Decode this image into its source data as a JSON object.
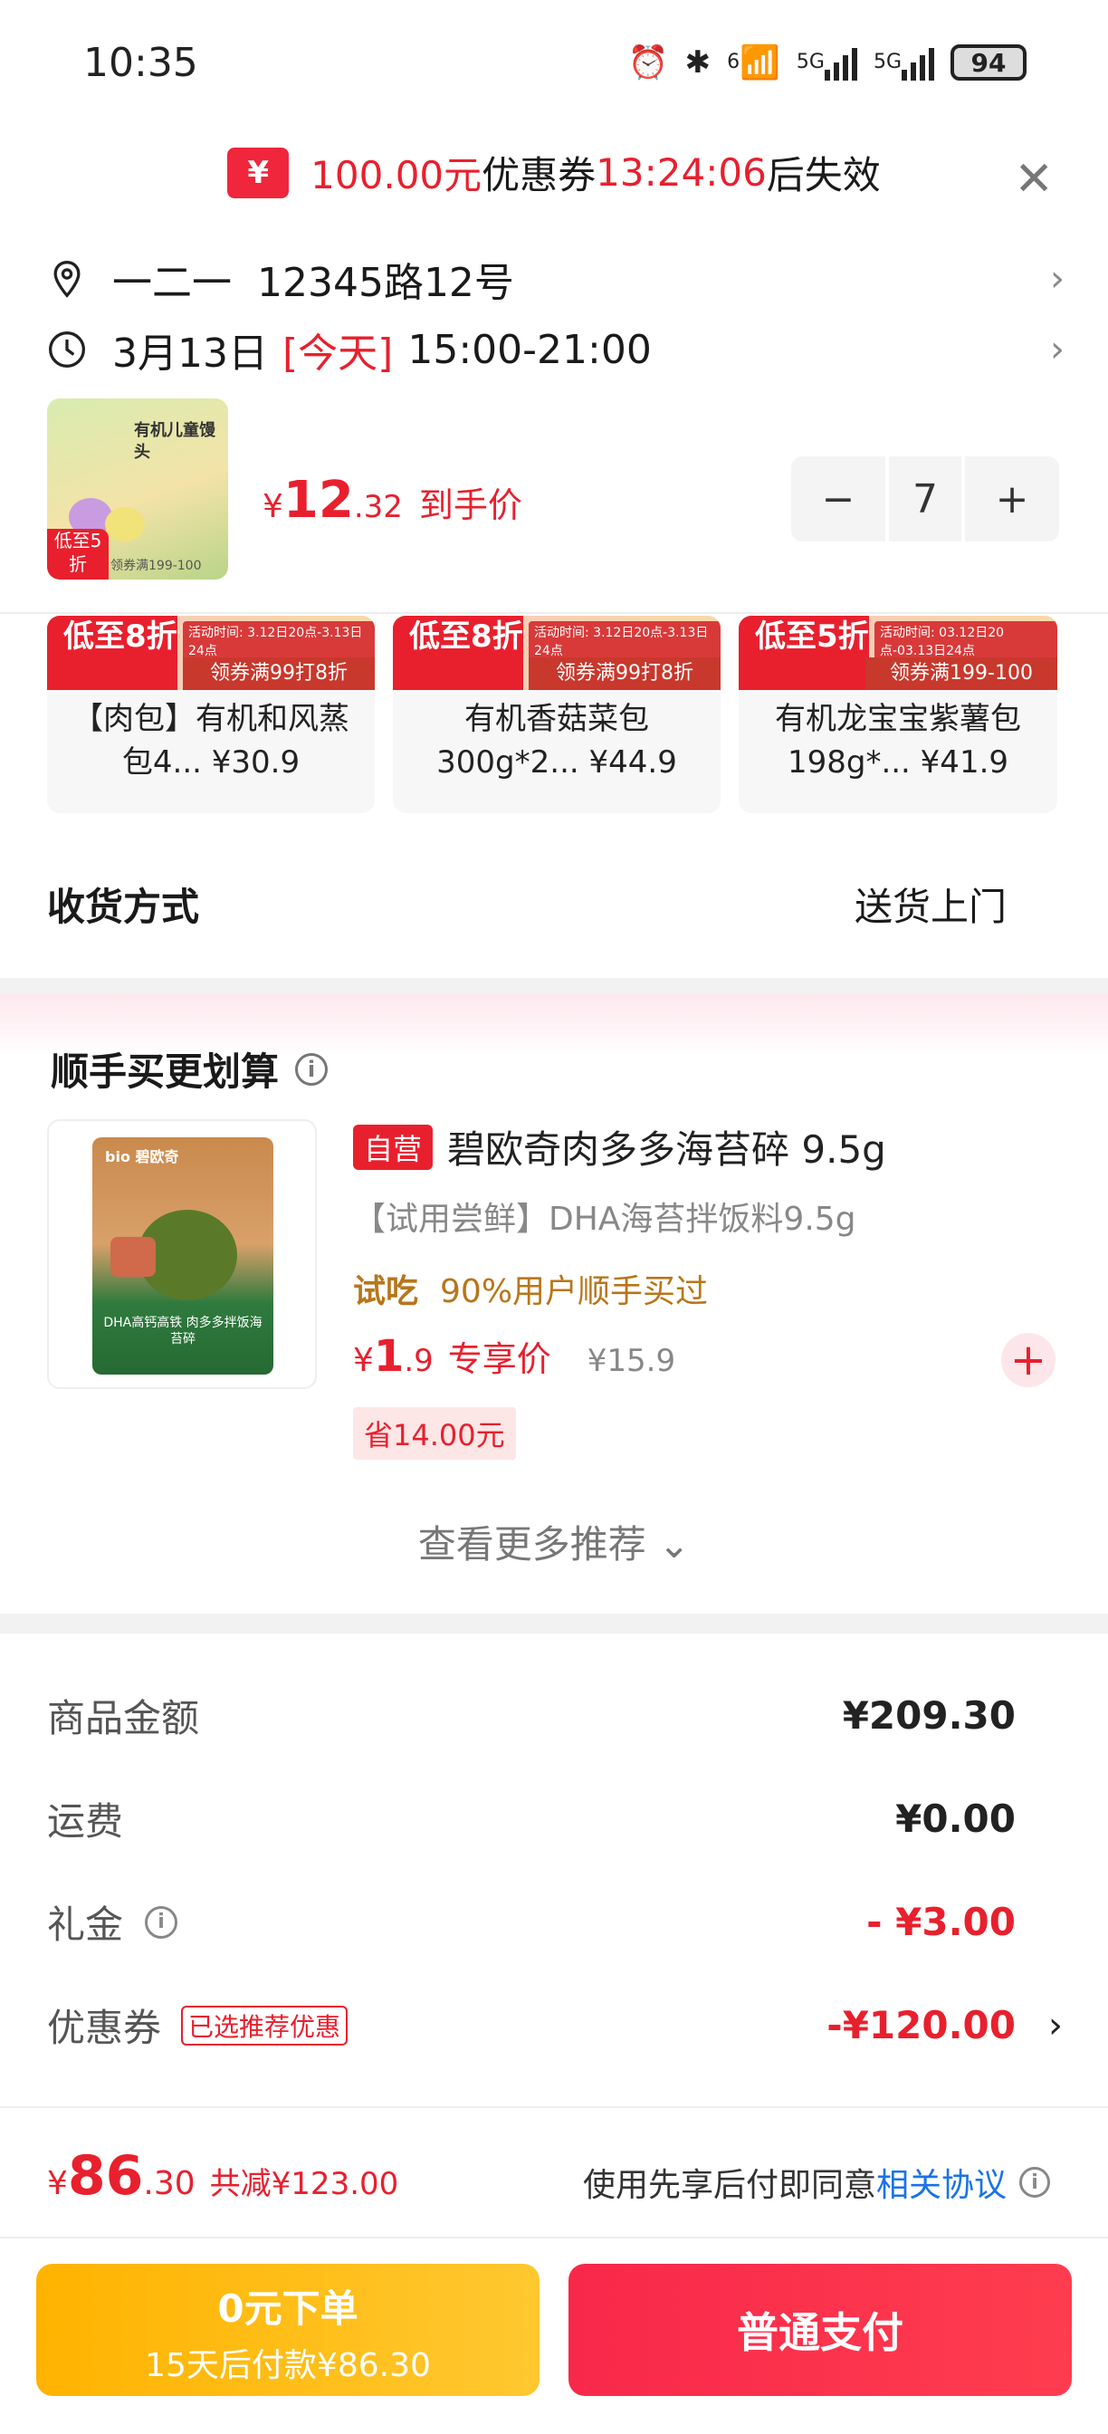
{
  "status_bar": {
    "time": "10:35",
    "signal_1": "5G",
    "signal_2": "5G",
    "wifi_label": "6",
    "battery": "94"
  },
  "coupon_banner": {
    "amount": "100.00元",
    "middle": "优惠券",
    "countdown": "13:24:06",
    "suffix": "后失效",
    "icon_char": "¥"
  },
  "address": {
    "text": "一二一  12345路12号"
  },
  "delivery_time": {
    "date": "3月13日",
    "today": "[今天]",
    "window": "15:00-21:00"
  },
  "product": {
    "thumb_name": "有机儿童馒头",
    "thumb_badge": "低至5折",
    "thumb_coupon": "领券满199-100",
    "price_currency": "¥",
    "price_int": "12",
    "price_dec": ".32",
    "price_label": "到手价",
    "quantity": "7",
    "minus": "−",
    "plus": "+"
  },
  "recommendations": [
    {
      "tag": "低至8折",
      "time": "活动时间: 3.12日20点-3.13日24点",
      "deal": "领券满99打8折",
      "title": "【肉包】有机和风蒸包4... ¥30.9"
    },
    {
      "tag": "低至8折",
      "time": "活动时间: 3.12日20点-3.13日24点",
      "deal": "领券满99打8折",
      "title": "有机香菇菜包300g*2... ¥44.9"
    },
    {
      "tag": "低至5折",
      "time": "活动时间: 03.12日20点-03.13日24点",
      "deal": "领券满199-100",
      "title": "有机龙宝宝紫薯包198g*... ¥41.9"
    }
  ],
  "shipping": {
    "label": "收货方式",
    "value": "送货上门"
  },
  "combo": {
    "title": "顺手买更划算",
    "info_icon": "i",
    "self_tag": "自营",
    "name": "碧欧奇肉多多海苔碎 9.5g",
    "sub": "【试用尝鲜】DHA海苔拌饭料9.5g",
    "trial_tag": "试吃",
    "trial_text": "90%用户顺手买过",
    "price_currency": "¥",
    "price_int": "1",
    "price_dec": ".9",
    "price_label": "专享价",
    "orig_price": "¥15.9",
    "save": "省14.00元",
    "bag_brand": "bio 碧欧奇",
    "bag_text": "DHA高钙高铁 肉多多拌饭海苔碎",
    "add": "+"
  },
  "more_rec": "查看更多推荐 ⌄",
  "summary": {
    "goods_label": "商品金额",
    "goods_value": "¥209.30",
    "freight_label": "运费",
    "freight_value": "¥0.00",
    "gift_label": "礼金",
    "gift_value": "- ¥3.00",
    "coupon_label": "优惠券",
    "coupon_badge": "已选推荐优惠",
    "coupon_value": "-¥120.00",
    "info_icon": "i"
  },
  "footer": {
    "total_currency": "¥",
    "total_int": "86",
    "total_dec": ".30",
    "total_reduce": "共减¥123.00",
    "agree_text": "使用先享后付即同意",
    "agree_link": "相关协议",
    "info_icon": "i",
    "pay_later_l1": "0元下单",
    "pay_later_l2": "15天后付款¥86.30",
    "pay_now": "普通支付"
  },
  "colors": {
    "accent_red": "#e8202e",
    "pay_later_yellow": "#ffb300",
    "pay_now_red": "#f8284a",
    "trial_brown": "#b8761a",
    "link_blue": "#1a73e8"
  }
}
